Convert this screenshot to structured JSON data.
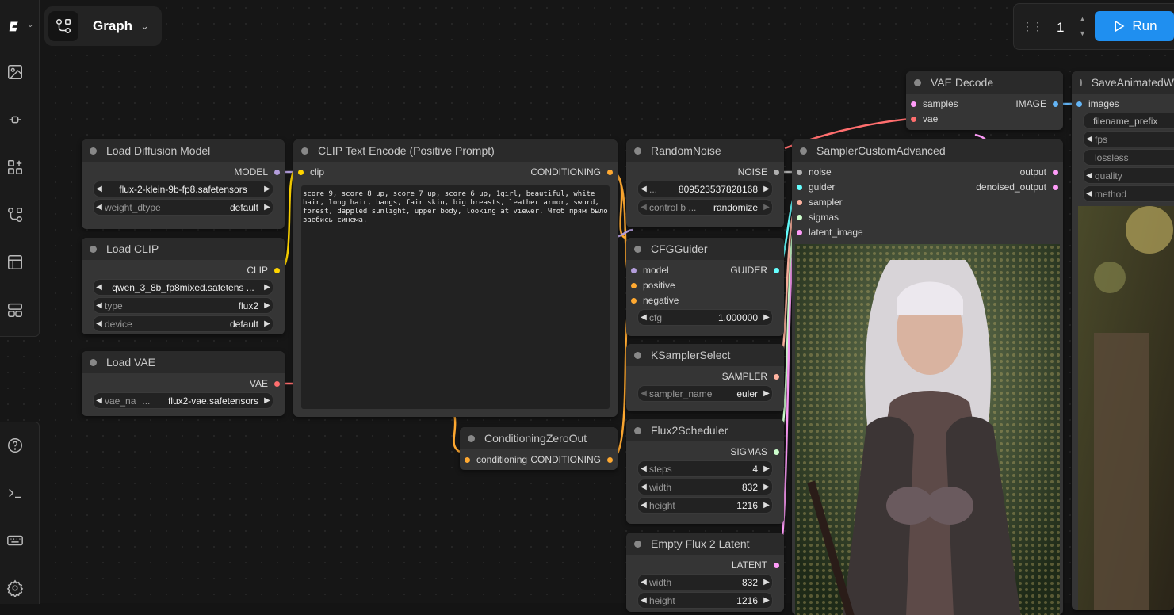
{
  "app": {
    "graph_tab_label": "Graph"
  },
  "leftbar": {
    "top_icons": [
      "comfy-logo-icon",
      "images-icon",
      "models-icon",
      "nodes-icon",
      "workflows-icon",
      "templates-icon",
      "layout-icon"
    ],
    "bottom_icons": [
      "help-icon",
      "terminal-icon",
      "keyboard-icon",
      "settings-icon"
    ]
  },
  "run": {
    "count": "1",
    "label": "Run",
    "color": "#1f8ff0"
  },
  "nodes": {
    "load_diffusion": {
      "title": "Load Diffusion Model",
      "out": "MODEL",
      "model": "flux-2-klein-9b-fp8.safetensors",
      "wd_label": "weight_dtype",
      "wd_value": "default"
    },
    "load_clip": {
      "title": "Load CLIP",
      "out": "CLIP",
      "clip_name": "qwen_3_8b_fp8mixed.safetens ...",
      "type_label": "type",
      "type_value": "flux2",
      "device_label": "device",
      "device_value": "default"
    },
    "load_vae": {
      "title": "Load VAE",
      "out": "VAE",
      "vae_label": "vae_na",
      "vae_ellipsis": "...",
      "vae_value": "flux2-vae.safetensors"
    },
    "clip_text": {
      "title": "CLIP Text Encode (Positive Prompt)",
      "in": "clip",
      "out": "CONDITIONING",
      "text": "score_9, score_8_up, score_7_up, score_6_up, 1girl, beautiful, white hair, long hair, bangs, fair skin, big breasts, leather armor, sword, forest, dappled sunlight, upper body, looking at viewer. Чтоб прям было заебись синема."
    },
    "zero_out": {
      "title": "ConditioningZeroOut",
      "in": "conditioning",
      "out": "CONDITIONING"
    },
    "random_noise": {
      "title": "RandomNoise",
      "out": "NOISE",
      "seed_ellipsis": "...",
      "seed": "809523537828168",
      "control_label": "control b ...",
      "control_value": "randomize"
    },
    "cfg_guider": {
      "title": "CFGGuider",
      "in_model": "model",
      "in_positive": "positive",
      "in_negative": "negative",
      "out": "GUIDER",
      "cfg_label": "cfg",
      "cfg_value": "1.000000"
    },
    "ksampler_select": {
      "title": "KSamplerSelect",
      "out": "SAMPLER",
      "sampler_label": "sampler_name",
      "sampler_value": "euler"
    },
    "flux2_scheduler": {
      "title": "Flux2Scheduler",
      "out": "SIGMAS",
      "steps_label": "steps",
      "steps_value": "4",
      "width_label": "width",
      "width_value": "832",
      "height_label": "height",
      "height_value": "1216"
    },
    "empty_latent": {
      "title": "Empty Flux 2 Latent",
      "out": "LATENT",
      "width_label": "width",
      "width_value": "832",
      "height_label": "height",
      "height_value": "1216"
    },
    "sampler_custom": {
      "title": "SamplerCustomAdvanced",
      "in_noise": "noise",
      "in_guider": "guider",
      "in_sampler": "sampler",
      "in_sigmas": "sigmas",
      "in_latent": "latent_image",
      "out_output": "output",
      "out_denoised": "denoised_output"
    },
    "vae_decode": {
      "title": "VAE Decode",
      "in_samples": "samples",
      "in_vae": "vae",
      "out": "IMAGE"
    },
    "save_animated": {
      "title": "SaveAnimatedW",
      "in_images": "images",
      "w_filename": "filename_prefix",
      "w_fps": "fps",
      "w_lossless": "lossless",
      "w_quality": "quality",
      "w_method": "method"
    }
  },
  "colors": {
    "model": "#b39ddb",
    "clip": "#ffd500",
    "vae": "#ff6e6e",
    "conditioning": "#ffa931",
    "noise": "#b0b0b0",
    "guider": "#66ffff",
    "sampler": "#ffb3a0",
    "sigmas": "#cdffcd",
    "latent": "#ff9cf9",
    "image": "#64b5f6"
  }
}
